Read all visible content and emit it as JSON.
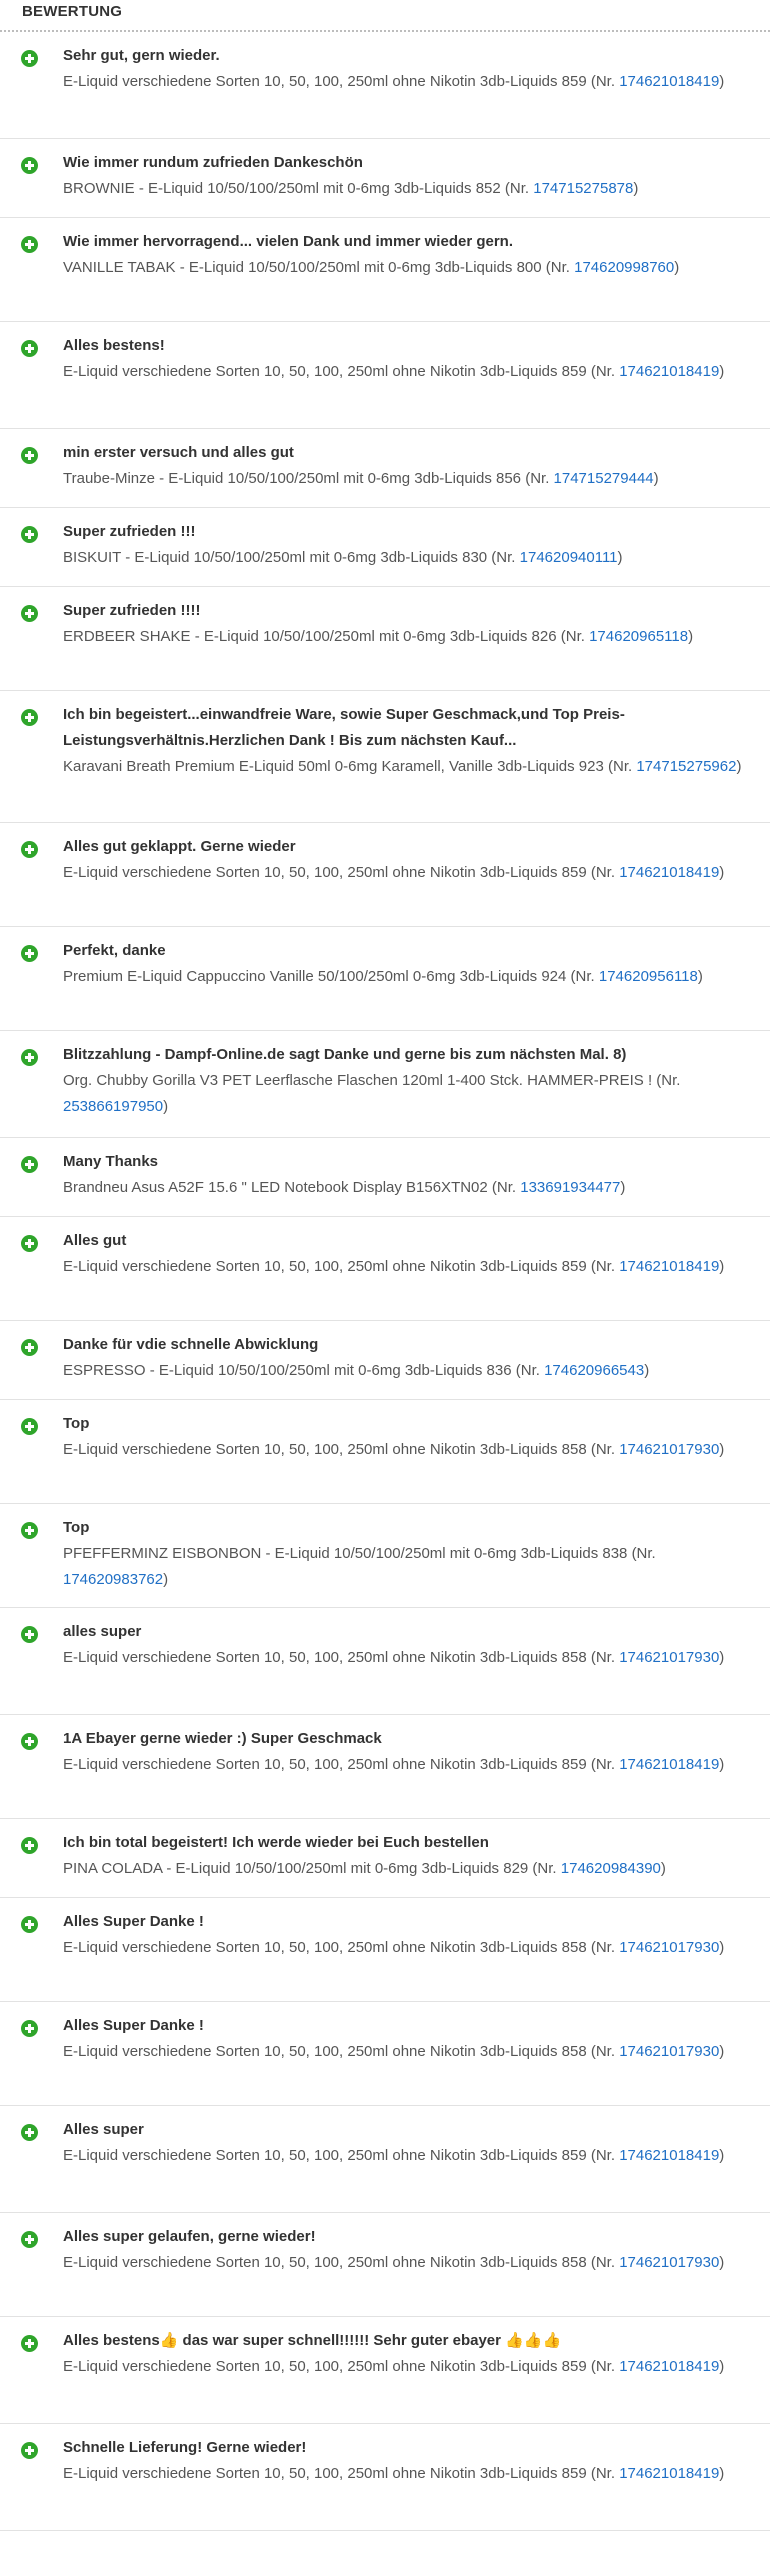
{
  "header": {
    "title": "BEWERTUNG"
  },
  "colors": {
    "positive": "#2fa52b",
    "link": "#1f6fc5",
    "text": "#333333",
    "subtext": "#555555"
  },
  "items": [
    {
      "comment": "Sehr gut, gern wieder.",
      "product": "E-Liquid verschiedene Sorten 10, 50, 100, 250ml ohne Nikotin 3db-Liquids 859 (Nr.",
      "nr": "174621018419",
      "tail": ")"
    },
    {
      "comment": "Wie immer rundum zufrieden Dankeschön",
      "product": "BROWNIE - E-Liquid 10/50/100/250ml mit 0-6mg 3db-Liquids 852 (Nr.",
      "nr": "174715275878",
      "tail": ")"
    },
    {
      "comment": "Wie immer hervorragend... vielen Dank und immer wieder gern.",
      "product": "VANILLE TABAK - E-Liquid 10/50/100/250ml mit 0-6mg 3db-Liquids 800 (Nr.",
      "nr": "174620998760",
      "tail": ")"
    },
    {
      "comment": "Alles bestens!",
      "product": "E-Liquid verschiedene Sorten 10, 50, 100, 250ml ohne Nikotin 3db-Liquids 859 (Nr.",
      "nr": "174621018419",
      "tail": ")"
    },
    {
      "comment": "min erster versuch und alles gut",
      "product": "Traube-Minze - E-Liquid 10/50/100/250ml mit 0-6mg 3db-Liquids 856 (Nr.",
      "nr": "174715279444",
      "tail": ")"
    },
    {
      "comment": "Super zufrieden !!!",
      "product": "BISKUIT - E-Liquid 10/50/100/250ml mit 0-6mg 3db-Liquids 830 (Nr.",
      "nr": "174620940111",
      "tail": ")"
    },
    {
      "comment": "Super zufrieden !!!!",
      "product": "ERDBEER SHAKE - E-Liquid 10/50/100/250ml mit 0-6mg 3db-Liquids 826 (Nr.",
      "nr": "174620965118",
      "tail": ")"
    },
    {
      "comment": "Ich bin begeistert...einwandfreie Ware, sowie Super Geschmack,und Top Preis-Leistungsverhältnis.Herzlichen Dank ! Bis zum nächsten Kauf...",
      "product": "Karavani Breath Premium E-Liquid 50ml 0-6mg Karamell, Vanille 3db-Liquids 923 (Nr.",
      "nr": "174715275962",
      "tail": ")"
    },
    {
      "comment": "Alles gut geklappt. Gerne wieder",
      "product": "E-Liquid verschiedene Sorten 10, 50, 100, 250ml ohne Nikotin 3db-Liquids 859 (Nr.",
      "nr": "174621018419",
      "tail": ")"
    },
    {
      "comment": "Perfekt, danke",
      "product": "Premium E-Liquid Cappuccino Vanille 50/100/250ml 0-6mg 3db-Liquids 924 (Nr.",
      "nr": "174620956118",
      "tail": ")"
    },
    {
      "comment": "Blitzzahlung - Dampf-Online.de sagt Danke und gerne bis zum nächsten Mal. 8)",
      "product": "Org. Chubby Gorilla V3 PET Leerflasche Flaschen 120ml 1-400 Stck. HAMMER-PREIS ! (Nr.",
      "nr": "253866197950",
      "tail": ")"
    },
    {
      "comment": "Many Thanks",
      "product": "Brandneu Asus A52F 15.6 \" LED Notebook Display B156XTN02 (Nr.",
      "nr": "133691934477",
      "tail": ")"
    },
    {
      "comment": "Alles gut",
      "product": "E-Liquid verschiedene Sorten 10, 50, 100, 250ml ohne Nikotin 3db-Liquids 859 (Nr.",
      "nr": "174621018419",
      "tail": ")"
    },
    {
      "comment": "Danke für vdie schnelle Abwicklung",
      "product": "ESPRESSO - E-Liquid 10/50/100/250ml mit 0-6mg 3db-Liquids 836 (Nr.",
      "nr": "174620966543",
      "tail": ")"
    },
    {
      "comment": "Top",
      "product": "E-Liquid verschiedene Sorten 10, 50, 100, 250ml ohne Nikotin 3db-Liquids 858 (Nr.",
      "nr": "174621017930",
      "tail": ")"
    },
    {
      "comment": "Top",
      "product": "PFEFFERMINZ EISBONBON - E-Liquid 10/50/100/250ml mit 0-6mg 3db-Liquids 838 (Nr.",
      "nr": "174620983762",
      "tail": ")"
    },
    {
      "comment": "alles super",
      "product": "E-Liquid verschiedene Sorten 10, 50, 100, 250ml ohne Nikotin 3db-Liquids 858 (Nr.",
      "nr": "174621017930",
      "tail": ")"
    },
    {
      "comment": "1A Ebayer gerne wieder :) Super Geschmack",
      "product": "E-Liquid verschiedene Sorten 10, 50, 100, 250ml ohne Nikotin 3db-Liquids 859 (Nr.",
      "nr": "174621018419",
      "tail": ")"
    },
    {
      "comment": "Ich bin total begeistert! Ich werde wieder bei Euch bestellen",
      "product": "PINA COLADA - E-Liquid 10/50/100/250ml mit 0-6mg 3db-Liquids 829 (Nr.",
      "nr": "174620984390",
      "tail": ")"
    },
    {
      "comment": "Alles Super Danke !",
      "product": "E-Liquid verschiedene Sorten 10, 50, 100, 250ml ohne Nikotin 3db-Liquids 858 (Nr.",
      "nr": "174621017930",
      "tail": ")"
    },
    {
      "comment": "Alles Super Danke !",
      "product": "E-Liquid verschiedene Sorten 10, 50, 100, 250ml ohne Nikotin 3db-Liquids 858 (Nr.",
      "nr": "174621017930",
      "tail": ")"
    },
    {
      "comment": "Alles super",
      "product": "E-Liquid verschiedene Sorten 10, 50, 100, 250ml ohne Nikotin 3db-Liquids 859 (Nr.",
      "nr": "174621018419",
      "tail": ")"
    },
    {
      "comment": "Alles super gelaufen, gerne wieder!",
      "product": "E-Liquid verschiedene Sorten 10, 50, 100, 250ml ohne Nikotin 3db-Liquids 858 (Nr.",
      "nr": "174621017930",
      "tail": ")"
    },
    {
      "comment": "Alles bestens👍 das war super schnell!!!!!! Sehr guter ebayer 👍👍👍",
      "product": "E-Liquid verschiedene Sorten 10, 50, 100, 250ml ohne Nikotin 3db-Liquids 859 (Nr.",
      "nr": "174621018419",
      "tail": ")"
    },
    {
      "comment": "Schnelle Lieferung! Gerne wieder!",
      "product": "E-Liquid verschiedene Sorten 10, 50, 100, 250ml ohne Nikotin 3db-Liquids 859 (Nr.",
      "nr": "174621018419",
      "tail": ")"
    }
  ]
}
